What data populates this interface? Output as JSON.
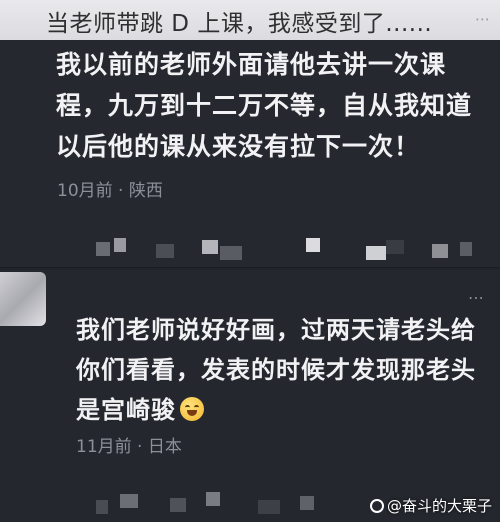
{
  "header": {
    "title": "当老师带跳 D 上课，我感受到了......",
    "more": "⋯"
  },
  "comments": [
    {
      "text": "我以前的老师外面请他去讲一次课程，九万到十二万不等，自从我知道以后他的课从来没有拉下一次！",
      "meta": "10月前 · 陕西"
    },
    {
      "text": "我们老师说好好画，过两天请老头给你们看看，发表的时候才发现那老头是宫崎骏",
      "meta": "11月前 · 日本",
      "more": "⋯",
      "emoji": "grin-sweat-emoji"
    }
  ],
  "watermark": "@奋斗的大栗子"
}
